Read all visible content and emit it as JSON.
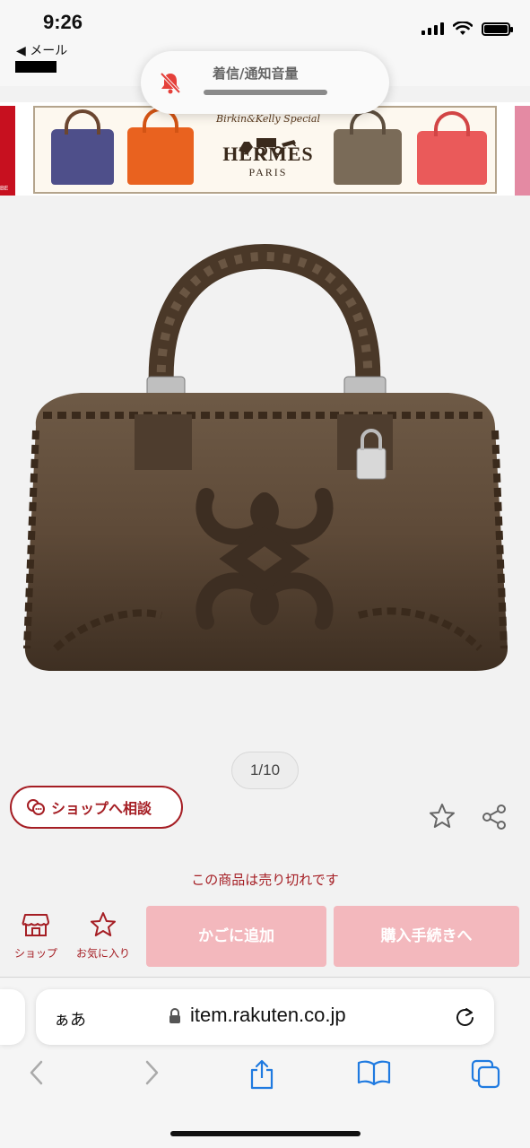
{
  "status_bar": {
    "time": "9:26",
    "back_app": "◀ メール",
    "icons": [
      "signal-icon",
      "wifi-icon",
      "battery-icon"
    ]
  },
  "volume_hud": {
    "label": "着信/通知音量",
    "icon": "bell-muted-icon"
  },
  "banner": {
    "tagline": "Birkin&Kelly Special",
    "brand": "HERMÈS",
    "city": "PARIS",
    "left_edge_text": "BE",
    "colors": {
      "left_edge": "#c7101f",
      "right_edge": "#e48aa3",
      "bags": [
        "#4e4f8a",
        "#e9621f",
        "#7a6b58",
        "#ea5a5a"
      ]
    }
  },
  "product": {
    "image": "brown-leather-handbag",
    "pager": "1/10"
  },
  "consult": {
    "label": "ショップへ相談",
    "icon": "chat-bubbles-icon"
  },
  "actions": {
    "favorite_icon": "star-outline-icon",
    "share_icon": "share-icon",
    "soldout_text": "この商品は売り切れです",
    "shop_label": "ショップ",
    "fav_label": "お気に入り",
    "cart_label": "かごに追加",
    "buy_label": "購入手続きへ"
  },
  "browser": {
    "aa_label": "ぁあ",
    "url": "item.rakuten.co.jp",
    "icons": [
      "lock-icon",
      "reload-icon",
      "back-icon",
      "forward-icon",
      "share-icon",
      "bookmarks-icon",
      "tabs-icon"
    ]
  },
  "colors": {
    "accent": "#a51e24",
    "button_disabled": "#f3b8bd",
    "ios_blue": "#1f7ae0"
  }
}
